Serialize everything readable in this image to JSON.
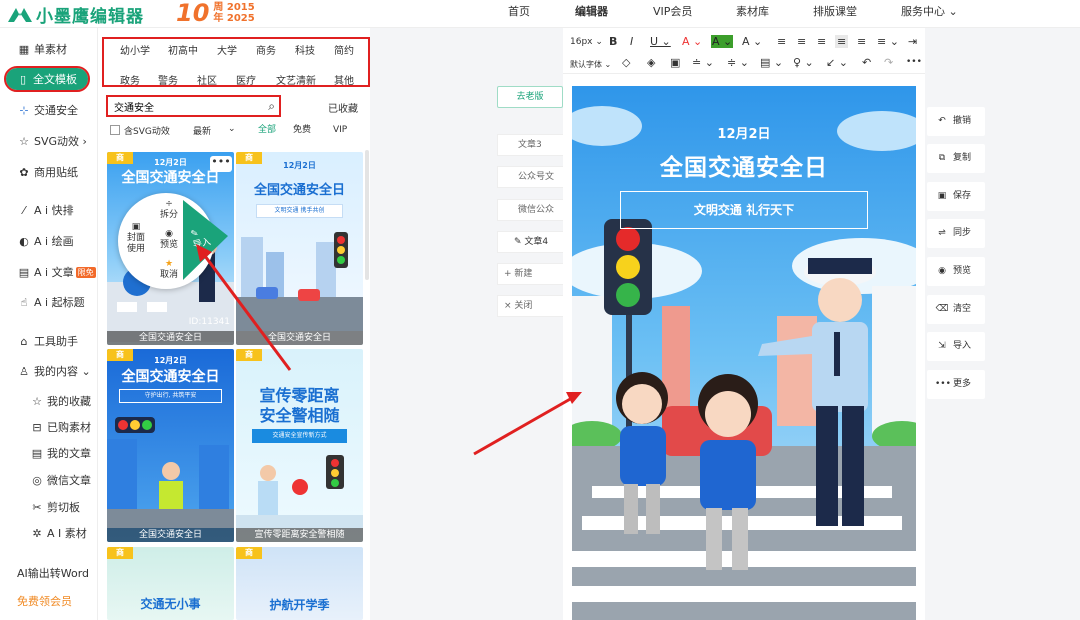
{
  "header": {
    "logo_text": "小墨鹰编辑器",
    "anniv_num": "10",
    "anniv_line1": "周 2015",
    "anniv_line2": "年 2025",
    "nav": [
      {
        "label": "首页"
      },
      {
        "label": "编辑器"
      },
      {
        "label": "VIP会员"
      },
      {
        "label": "素材库"
      },
      {
        "label": "排版课堂"
      },
      {
        "label": "服务中心 ⌄"
      }
    ]
  },
  "sidebar": {
    "items": [
      {
        "label": "单素材",
        "icon": "grid-icon"
      },
      {
        "label": "全文模板",
        "icon": "template-icon"
      },
      {
        "label": "交通安全",
        "icon": "pin-icon"
      },
      {
        "label": "SVG动效 ›",
        "icon": "star-icon"
      },
      {
        "label": "商用贴纸",
        "icon": "sticker-icon"
      },
      {
        "label": "A i 快排",
        "icon": "ai-layout-icon"
      },
      {
        "label": "A i 绘画",
        "icon": "palette-icon"
      },
      {
        "label": "A i 文章",
        "icon": "doc-icon",
        "badge": "限免"
      },
      {
        "label": "A i 起标题",
        "icon": "hand-icon"
      },
      {
        "label": "工具助手",
        "icon": "tool-icon"
      },
      {
        "label": "我的内容 ⌄",
        "icon": "user-icon"
      },
      {
        "label": "我的收藏",
        "icon": "star-outline-icon"
      },
      {
        "label": "已购素材",
        "icon": "cart-icon"
      },
      {
        "label": "我的文章",
        "icon": "article-icon"
      },
      {
        "label": "微信文章",
        "icon": "wechat-icon"
      },
      {
        "label": "剪切板",
        "icon": "scissors-icon"
      },
      {
        "label": "A I 素材",
        "icon": "sparkle-icon"
      },
      {
        "label": "AI输出转Word",
        "icon": ""
      },
      {
        "label": "免费领会员",
        "icon": ""
      }
    ]
  },
  "categories": [
    "幼小学",
    "初高中",
    "大学",
    "商务",
    "科技",
    "简约",
    "政务",
    "警务",
    "社区",
    "医疗",
    "文艺清新",
    "其他"
  ],
  "search": {
    "value": "交通安全",
    "collected": "已收藏"
  },
  "filters": {
    "svg_label": "含SVG动效",
    "sort": "最新",
    "tabs": [
      "全部",
      "免费",
      "VIP"
    ]
  },
  "cards": [
    {
      "caption": "全国交通安全日",
      "title": "全国交通安全日",
      "date": "12月2日",
      "id_label": "ID:11341",
      "tag": "商"
    },
    {
      "caption": "全国交通安全日",
      "title": "全国交通安全日",
      "date": "12月2日",
      "sub": "文明交通 携手共创",
      "tag": "商"
    },
    {
      "caption": "全国交通安全日",
      "title": "全国交通安全日",
      "date": "12月2日",
      "sub": "守护出行, 共筑平安",
      "tag": "商"
    },
    {
      "caption": "宣传零距离安全警相随",
      "title_l1": "宣传零距离",
      "title_l2": "安全警相随",
      "sub": "交通安全宣传新方式",
      "tag": "商"
    },
    {
      "title": "交通无小事",
      "tag": "商"
    },
    {
      "title": "护航开学季",
      "tag": "商"
    }
  ],
  "context_menu": {
    "split": "拆分",
    "cover_l1": "封面",
    "cover_l2": "使用",
    "preview": "预览",
    "import": "导入",
    "cancel": "取消"
  },
  "doc_tabs": {
    "old": "去老版",
    "items": [
      "文章3",
      "公众号文",
      "微信公众",
      "文章4",
      "+ 新建",
      "× 关闭"
    ]
  },
  "toolbar": {
    "font_size": "16px ⌄",
    "font_family": "默认字体 ⌄",
    "row1": [
      "B",
      "I",
      "U ⌄",
      "A ⌄",
      "A ⌄",
      "A ⌄",
      "≡",
      "≡",
      "≡",
      "≡",
      "≡",
      "≡ ⌄",
      "⇥"
    ],
    "row2": [
      "◇",
      "◈",
      "▣",
      "≐ ⌄",
      "≑ ⌄",
      "▤ ⌄",
      "♀ ⌄",
      "↙ ⌄",
      "↶",
      "↷",
      "•••"
    ]
  },
  "poster": {
    "date": "12月2日",
    "title": "全国交通安全日",
    "slogan": "文明交通 礼行天下"
  },
  "actions": [
    {
      "label": "撤销",
      "icon": "undo-icon"
    },
    {
      "label": "复制",
      "icon": "copy-icon"
    },
    {
      "label": "保存",
      "icon": "save-icon"
    },
    {
      "label": "同步",
      "icon": "sync-icon"
    },
    {
      "label": "预览",
      "icon": "eye-icon"
    },
    {
      "label": "清空",
      "icon": "trash-icon"
    },
    {
      "label": "导入",
      "icon": "import-icon"
    },
    {
      "label": "更多",
      "icon": "more-icon"
    }
  ],
  "colors": {
    "brand": "#1aa37a",
    "accent": "#f0722c",
    "highlight": "#e02020"
  }
}
